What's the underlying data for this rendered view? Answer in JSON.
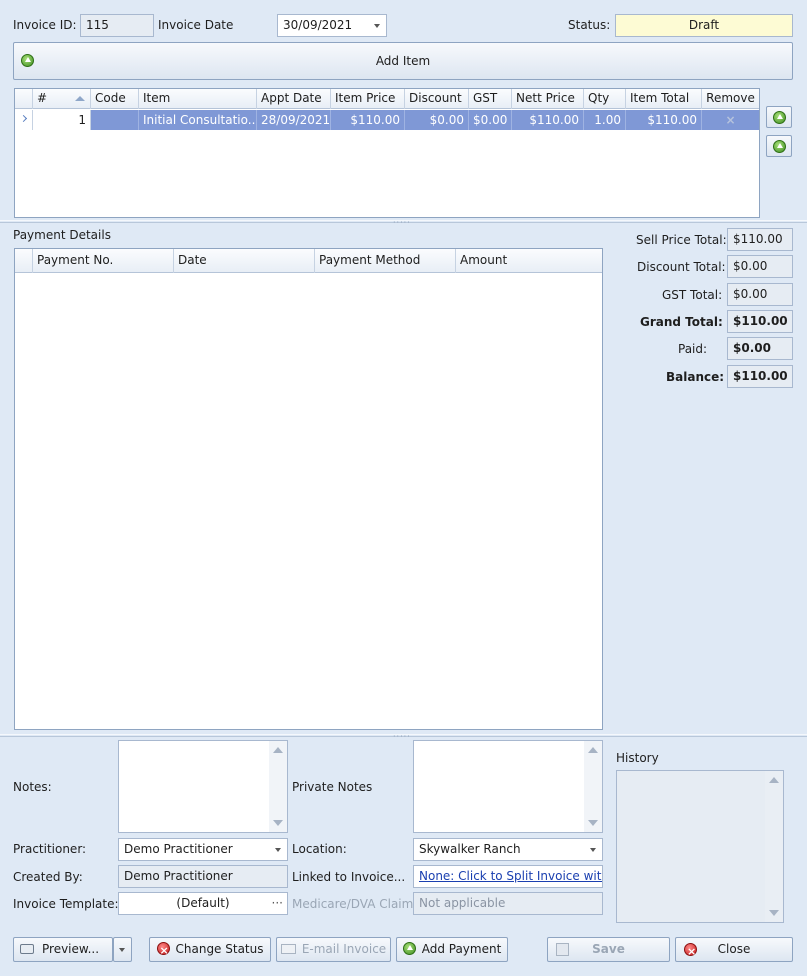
{
  "header": {
    "invoice_id_label": "Invoice ID:",
    "invoice_id": "115",
    "invoice_date_label": "Invoice Date",
    "invoice_date": "30/09/2021",
    "status_label": "Status:",
    "status": "Draft"
  },
  "add_item_label": "Add Item",
  "items_table": {
    "columns": [
      "#",
      "Code",
      "Item",
      "Appt Date",
      "Item Price",
      "Discount",
      "GST",
      "Nett Price",
      "Qty",
      "Item Total",
      "Remove"
    ],
    "rows": [
      [
        "1",
        "",
        "Initial Consultatio...",
        "28/09/2021",
        "$110.00",
        "$0.00",
        "$0.00",
        "$110.00",
        "1.00",
        "$110.00",
        "×"
      ]
    ]
  },
  "payment_details_label": "Payment Details",
  "payments_table": {
    "columns": [
      "Payment No.",
      "Date",
      "Payment Method",
      "Amount"
    ]
  },
  "totals": {
    "sell_price_label": "Sell Price Total:",
    "sell_price": "$110.00",
    "discount_label": "Discount Total:",
    "discount": "$0.00",
    "gst_label": "GST Total:",
    "gst": "$0.00",
    "grand_label": "Grand Total:",
    "grand": "$110.00",
    "paid_label": "Paid:",
    "paid": "$0.00",
    "balance_label": "Balance:",
    "balance": "$110.00"
  },
  "form": {
    "notes_label": "Notes:",
    "private_notes_label": "Private Notes",
    "history_label": "History",
    "practitioner_label": "Practitioner:",
    "practitioner": "Demo Practitioner",
    "location_label": "Location:",
    "location": "Skywalker Ranch",
    "created_by_label": "Created By:",
    "created_by": "Demo Practitioner",
    "linked_label": "Linked to Invoice...",
    "linked": "None: Click to Split Invoice wit...",
    "template_label": "Invoice Template:",
    "template": "(Default)",
    "template_ellipsis": "···",
    "medicare_label": "Medicare/DVA Claim:",
    "medicare": "Not applicable"
  },
  "buttons": {
    "preview": "Preview...",
    "change_status": "Change Status",
    "email_invoice": "E-mail Invoice",
    "add_payment": "Add Payment",
    "save": "Save",
    "close": "Close"
  },
  "colors": {
    "background": "#dfe9f5",
    "status_bg": "#fdfbd4",
    "selected_row": "#7f98d6"
  }
}
